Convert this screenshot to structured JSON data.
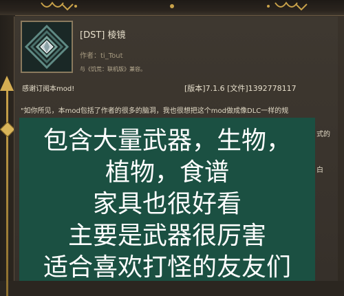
{
  "mod": {
    "title": "[DST] 棱镜",
    "author": "作者：ti_Tout",
    "compat": "与《饥荒：联机版》兼容。",
    "thanks": "感谢订阅本mod!",
    "version": "[版本]7.1.6  [文件]1392778117",
    "description_line1": "\"如你所见，本mod包括了作者的很多的脑洞，我也很想把这个mod做成像DLC一样的规",
    "desc_frag_right1": "式的",
    "desc_frag_right2": "白"
  },
  "overlay": {
    "lines": [
      "包含大量武器，生物，",
      "植物，食谱",
      "家具也很好看",
      "主要是武器很厉害",
      "适合喜欢打怪的友友们"
    ],
    "background": "#1b5042"
  },
  "colors": {
    "accent_gold": "#d4ad52"
  },
  "icons": {
    "mod_icon": "prism-crystal-icon",
    "rail_gem": "diamond-gem-icon"
  }
}
